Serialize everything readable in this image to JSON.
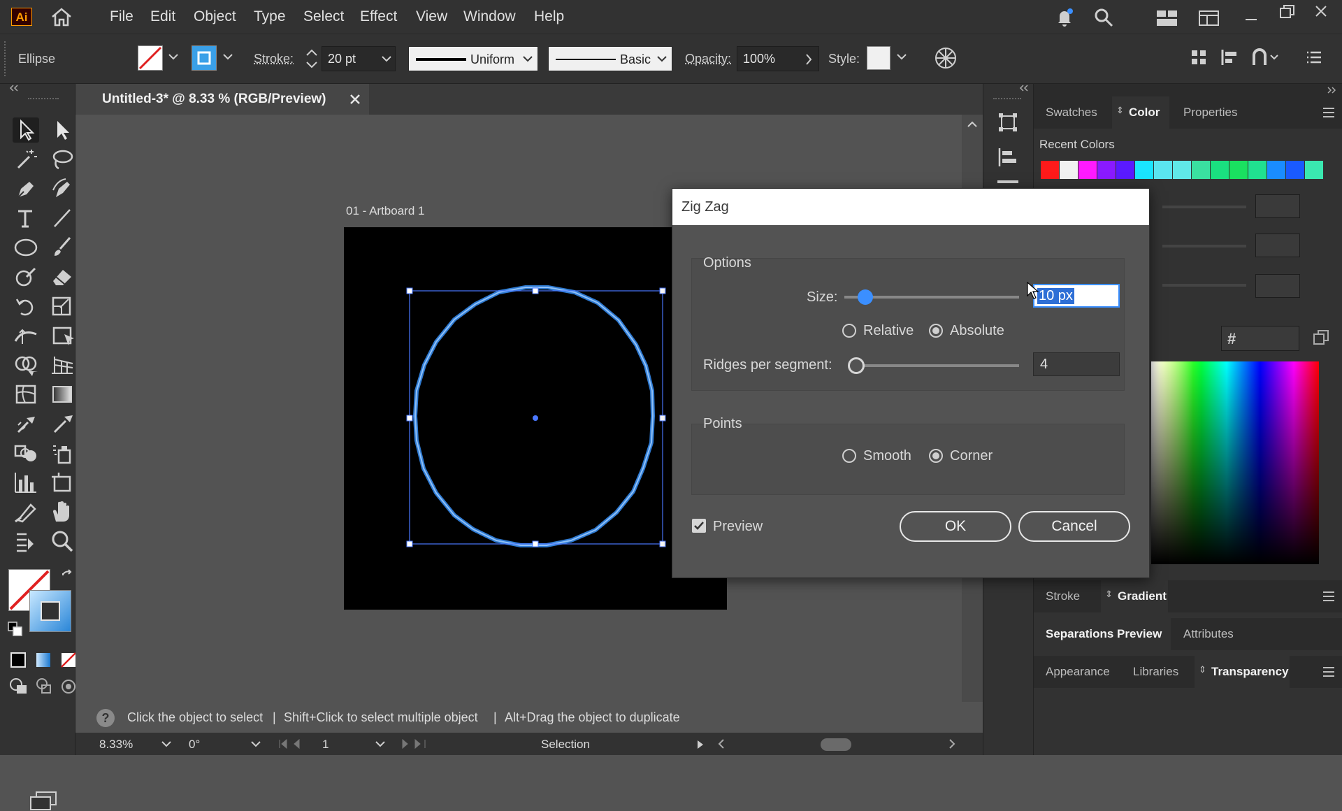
{
  "app": {
    "logo": "Ai"
  },
  "menu": {
    "items": [
      "File",
      "Edit",
      "Object",
      "Type",
      "Select",
      "Effect",
      "View",
      "Window",
      "Help"
    ]
  },
  "control": {
    "object_type": "Ellipse",
    "stroke_label": "Stroke:",
    "stroke_value": "20 pt",
    "profile": "Uniform",
    "brush": "Basic",
    "opacity_label": "Opacity:",
    "opacity_value": "100%",
    "style_label": "Style:"
  },
  "document": {
    "tab_title": "Untitled-3* @ 8.33 % (RGB/Preview)",
    "artboard_label": "01 - Artboard 1"
  },
  "status": {
    "help_text_1": "Click the object to select",
    "sep": "|",
    "help_text_2": "Shift+Click to select multiple object",
    "help_text_3": "Alt+Drag the object to duplicate",
    "zoom": "8.33%",
    "rotation": "0°",
    "artboard_num": "1",
    "tool_name": "Selection"
  },
  "panels": {
    "top_tabs": [
      "Swatches",
      "Color",
      "Properties"
    ],
    "active_top_tab": "Color",
    "recent_colors_label": "Recent Colors",
    "recent_colors": [
      "#ff1a1a",
      "#f2f2f2",
      "#ff1aff",
      "#8a1aff",
      "#5a1aff",
      "#1ae5ff",
      "#5ae5f0",
      "#60e8e8",
      "#3ae0a0",
      "#1ae080",
      "#1ae060",
      "#20e090",
      "#1a8cff",
      "#1a5aff",
      "#3ae8b0"
    ],
    "hex_label": "#",
    "mid_tabs": [
      "Stroke",
      "Gradient"
    ],
    "row3_tabs": [
      "Separations Preview",
      "Attributes"
    ],
    "row4_tabs": [
      "Appearance",
      "Libraries",
      "Transparency"
    ]
  },
  "dialog": {
    "title": "Zig Zag",
    "options_label": "Options",
    "size_label": "Size:",
    "size_value": "10 px",
    "size_slider_fraction": 0.12,
    "relative_label": "Relative",
    "absolute_label": "Absolute",
    "ridges_label": "Ridges per segment:",
    "ridges_value": "4",
    "ridges_slider_fraction": 0.02,
    "points_label": "Points",
    "smooth_label": "Smooth",
    "corner_label": "Corner",
    "preview_label": "Preview",
    "preview_checked": true,
    "ok_label": "OK",
    "cancel_label": "Cancel"
  }
}
